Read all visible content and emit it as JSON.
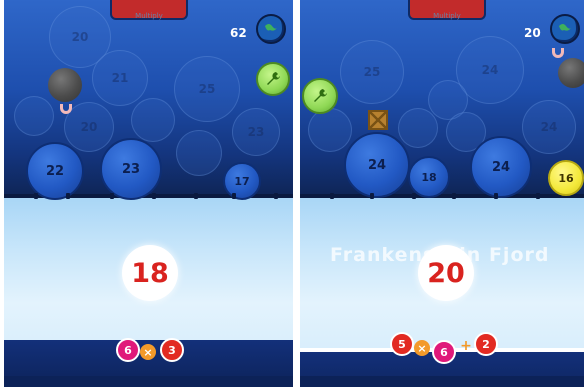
{
  "left": {
    "top_tab_label": "Multiply",
    "score": "62",
    "target": "18",
    "ghost_bubbles": [
      "20",
      "21",
      "25",
      "20",
      "23",
      "24",
      "18"
    ],
    "solid_bubbles": [
      "22",
      "23",
      "17"
    ],
    "equation": {
      "a": "6",
      "op": "×",
      "b": "3"
    }
  },
  "right": {
    "top_tab_label": "Multiply",
    "score": "20",
    "target": "20",
    "location_name": "Frankenstein Fjord",
    "ghost_bubbles": [
      "25",
      "24",
      "24",
      "20",
      "23",
      "18",
      "24"
    ],
    "solid_bubbles": [
      "24",
      "18",
      "24"
    ],
    "yellow_bubble": "16",
    "equation": {
      "a": "5",
      "op1": "×",
      "b": "6",
      "op2": "+",
      "c": "2"
    }
  },
  "colors": {
    "water_top": "#2f67c9",
    "water_bottom": "#0e2454",
    "ice": "#c8e6fa",
    "target_text": "#d9231f",
    "ball_pink": "#e0197a",
    "ball_red": "#e22a22",
    "operator": "#f39a2a",
    "powerup_green": "#8fd855",
    "bonus_yellow": "#f3e93a"
  },
  "icons": [
    "globe-icon",
    "wrench-icon",
    "mine-icon",
    "crate-icon"
  ]
}
